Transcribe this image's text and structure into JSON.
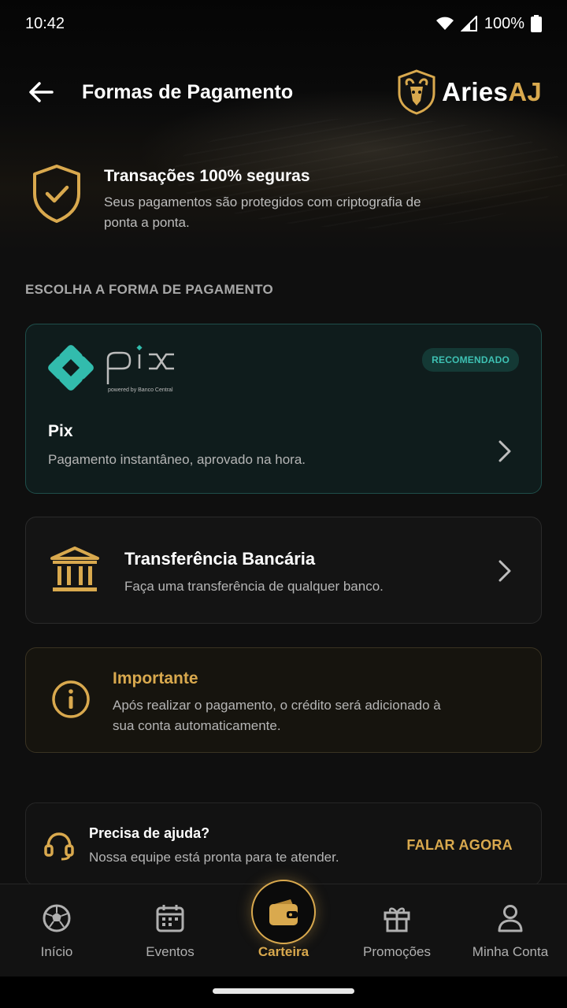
{
  "status_bar": {
    "time": "10:42",
    "battery": "100%"
  },
  "header": {
    "title": "Formas de Pagamento",
    "brand_main": "Aries",
    "brand_accent": "AJ"
  },
  "security": {
    "title": "Transações 100% seguras",
    "description": "Seus pagamentos são protegidos com criptografia de ponta a ponta."
  },
  "section_label": "ESCOLHA A FORMA DE PAGAMENTO",
  "payment_methods": {
    "pix": {
      "logo_text": "pix",
      "logo_sub": "powered by Banco Central",
      "badge": "RECOMENDADO",
      "title": "Pix",
      "description": "Pagamento instantâneo, aprovado na hora."
    },
    "bank": {
      "title": "Transferência Bancária",
      "description": "Faça uma transferência de qualquer banco."
    }
  },
  "notice": {
    "title": "Importante",
    "description": "Após realizar o pagamento, o crédito será adicionado à sua conta automaticamente."
  },
  "help": {
    "title": "Precisa de ajuda?",
    "description": "Nossa equipe está pronta para te atender.",
    "action": "FALAR AGORA"
  },
  "bottom_nav": {
    "items": [
      {
        "label": "Início",
        "icon": "soccer-ball-icon"
      },
      {
        "label": "Eventos",
        "icon": "calendar-icon"
      },
      {
        "label": "Carteira",
        "icon": "wallet-icon",
        "active": true
      },
      {
        "label": "Promoções",
        "icon": "gift-icon"
      },
      {
        "label": "Minha Conta",
        "icon": "user-icon"
      }
    ]
  },
  "colors": {
    "accent_gold": "#d9a94e",
    "pix_teal": "#32bcad",
    "background": "#0f0f0f"
  }
}
